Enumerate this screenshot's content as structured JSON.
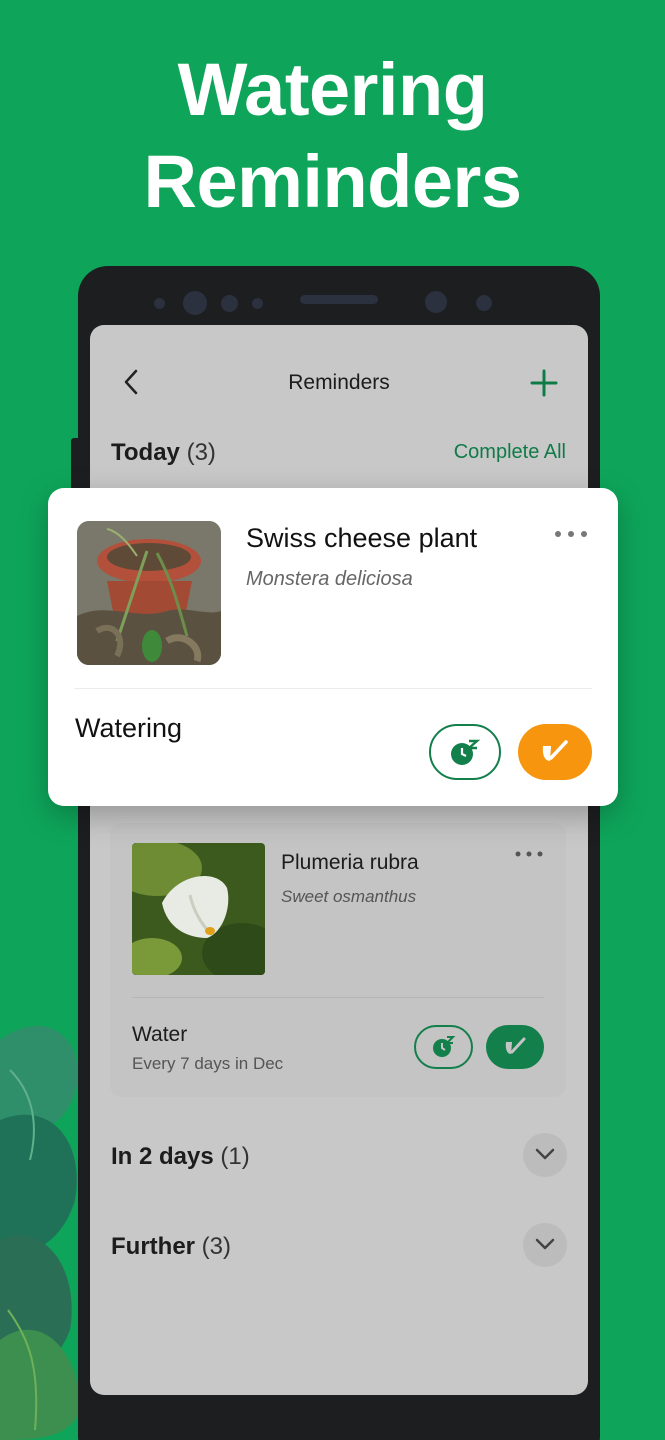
{
  "headline": {
    "line1": "Watering",
    "line2": "Reminders"
  },
  "nav": {
    "title": "Reminders",
    "back_icon": "chevron-left-icon",
    "add_icon": "plus-icon"
  },
  "today": {
    "label": "Today",
    "count": "(3)",
    "action": "Complete All"
  },
  "featured_card": {
    "name": "Swiss cheese plant",
    "scientific_name": "Monstera deliciosa",
    "task": "Watering",
    "snooze_icon": "snooze-icon",
    "done_icon": "check-icon",
    "done_color": "#f7960e"
  },
  "reminder_card": {
    "name": "Plumeria rubra",
    "scientific_name": "Sweet osmanthus",
    "task": "Water",
    "frequency": "Every 7 days in Dec"
  },
  "in_two_days": {
    "label": "In 2 days",
    "count": "(1)"
  },
  "further": {
    "label": "Further",
    "count": "(3)"
  },
  "colors": {
    "background": "#0ea55a",
    "accent": "#137f4a",
    "screen_overlay": "#c8c8c8"
  }
}
